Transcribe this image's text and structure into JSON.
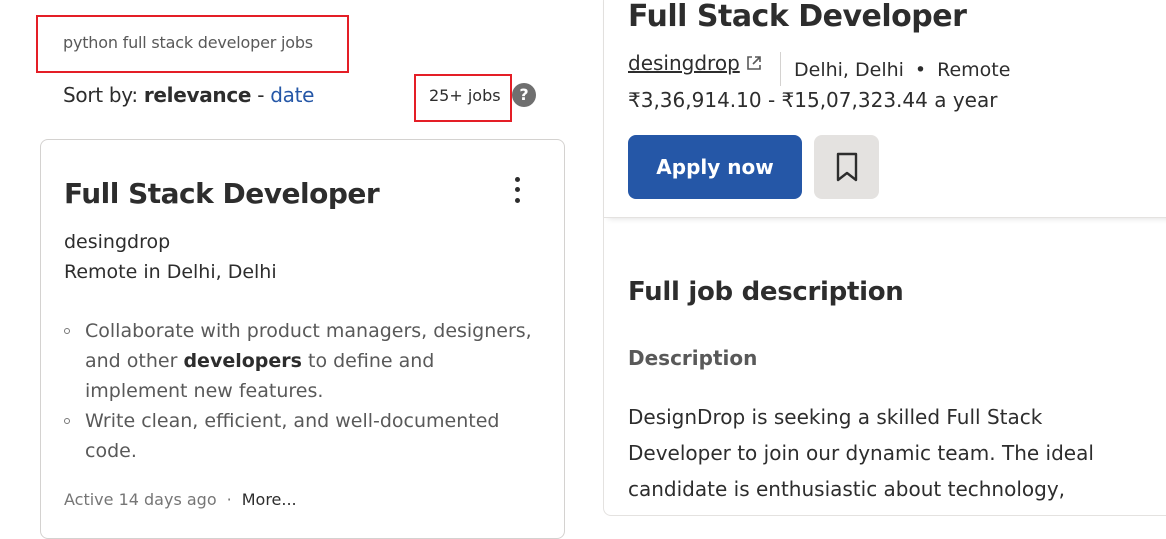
{
  "search": {
    "query": "python full stack developer jobs",
    "sort_prefix": "Sort by:",
    "sort_active": "relevance",
    "sort_sep": "-",
    "sort_alt": "date",
    "count": "25+ jobs"
  },
  "card": {
    "title": "Full Stack Developer",
    "company": "desingdrop",
    "location": "Remote in Delhi, Delhi",
    "bullet1_a": "Collaborate with product managers, designers, and other ",
    "bullet1_b": "developers",
    "bullet1_c": " to define and implement new features.",
    "bullet2": "Write clean, efficient, and well-documented code.",
    "active": "Active 14 days ago",
    "dot": "·",
    "more": "More..."
  },
  "detail": {
    "title": "Full Stack Developer",
    "company": "desingdrop",
    "city": "Delhi, Delhi",
    "dot": "•",
    "work_type": "Remote",
    "salary": "₹3,36,914.10 - ₹15,07,323.44 a year",
    "apply_label": "Apply now",
    "full_desc_heading": "Full job description",
    "desc_heading": "Description",
    "desc_body": "DesignDrop is seeking a skilled Full Stack Developer to join our dynamic team. The ideal candidate is enthusiastic about technology,"
  },
  "icons": {
    "help": "question-mark-circle",
    "kebab": "vertical-dots",
    "external": "external-link",
    "save": "bookmark"
  },
  "colors": {
    "accent": "#2557a7",
    "highlight_box": "#e41e26",
    "text": "#2d2d2d",
    "muted": "#595959"
  }
}
